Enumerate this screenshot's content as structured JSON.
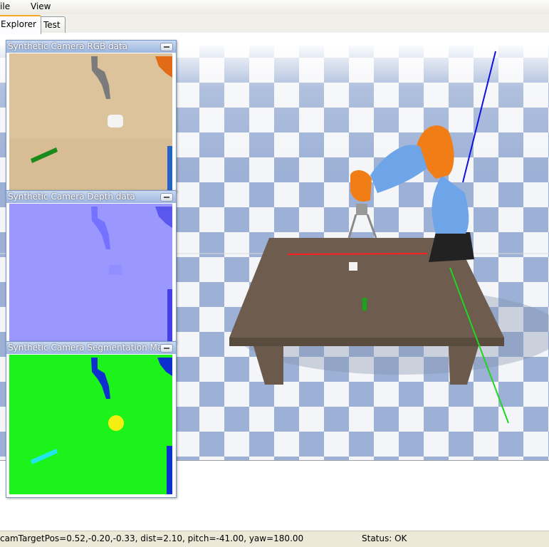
{
  "menu": {
    "file": "File",
    "view": "View"
  },
  "tabs": [
    {
      "label": "Explorer"
    },
    {
      "label": "Test"
    }
  ],
  "camera_windows": {
    "rgb": {
      "title": "Synthetic Camera RGB data"
    },
    "depth": {
      "title": "Synthetic Camera Depth data"
    },
    "segmentation": {
      "title": "Synthetic Camera Segmentation Mask"
    }
  },
  "status": {
    "camera": "camTargetPos=0.52,-0.20,-0.33, dist=2.10, pitch=-41.00, yaw=180.00",
    "state": "Status: OK"
  },
  "colors": {
    "floor_blue": "#9db1d6",
    "robot_blue": "#6ea5e8",
    "robot_orange": "#f07d16",
    "table_brown": "#6e5d4e",
    "seg_green": "#1bf31b",
    "depth_violet": "#9a97ff"
  }
}
